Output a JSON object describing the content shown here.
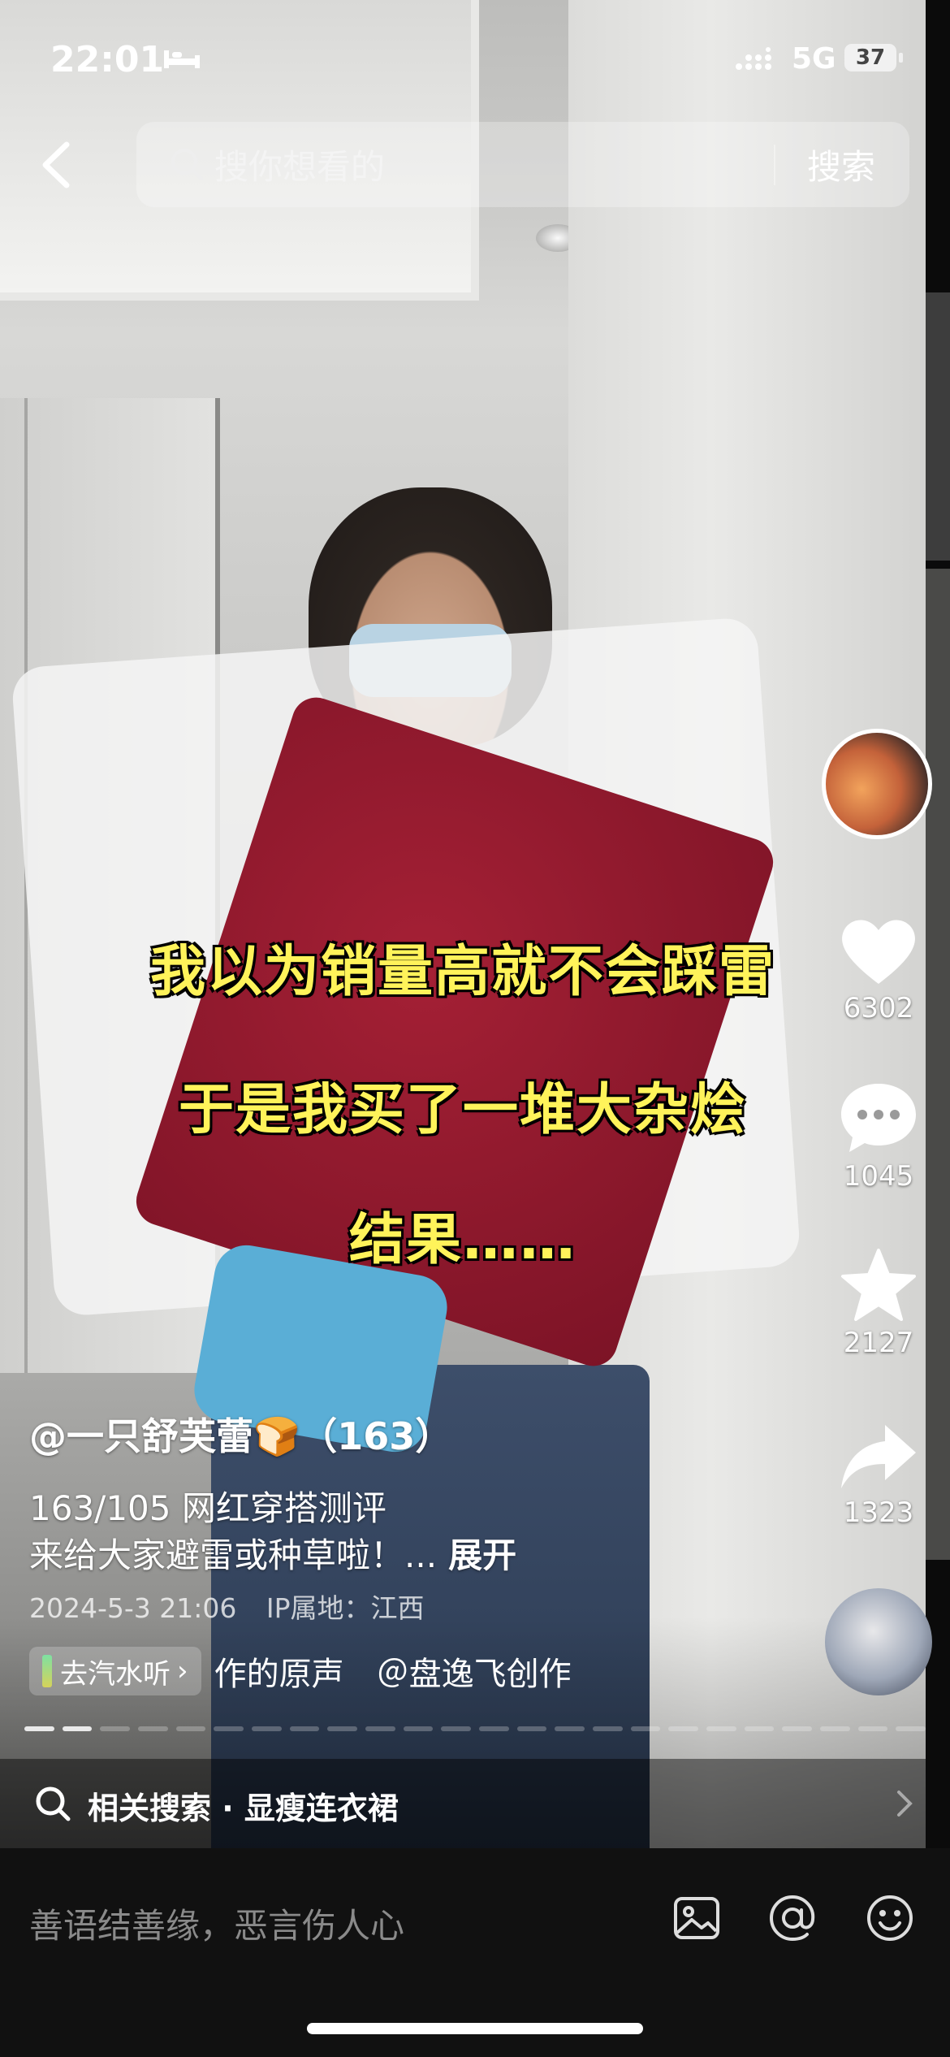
{
  "status_bar": {
    "time": "22:01",
    "network": "5G",
    "battery": "37"
  },
  "search": {
    "placeholder": "搜你想看的",
    "button": "搜索"
  },
  "captions": [
    "我以为销量高就不会踩雷",
    "于是我买了一堆大杂烩",
    "结果……"
  ],
  "actions": {
    "likes": "6302",
    "comments": "1045",
    "favorites": "2127",
    "shares": "1323"
  },
  "post": {
    "author": "@一只舒芙蕾🍞（163）",
    "desc_line1": "163/105 网红穿搭测评",
    "desc_line2": "来给大家避雷或种草啦！...",
    "expand": "展开",
    "date": "2024-5-3 21:06",
    "ip": "IP属地：江西"
  },
  "music": {
    "qishui_label": "去汽水听",
    "title": "作的原声　＠盘逸飞创作"
  },
  "progress": {
    "segments": 24,
    "active": [
      0,
      1
    ]
  },
  "related": {
    "text": "相关搜索 · 显瘦连衣裙"
  },
  "comment": {
    "placeholder": "善语结善缘，恶言伤人心"
  },
  "icons": [
    "back-icon",
    "search-icon",
    "heart-icon",
    "comment-icon",
    "star-icon",
    "share-icon",
    "image-icon",
    "at-icon",
    "emoji-icon",
    "chevron-right-icon"
  ]
}
